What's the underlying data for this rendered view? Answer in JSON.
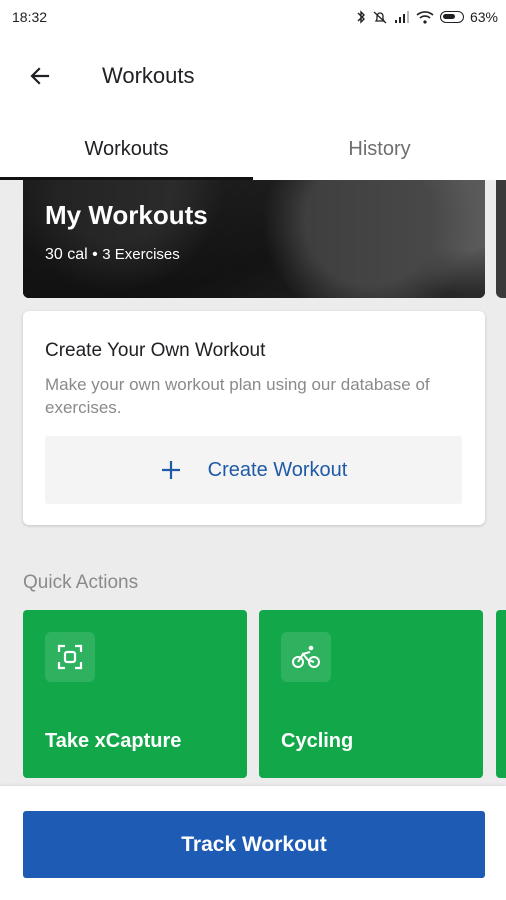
{
  "status_bar": {
    "time": "18:32",
    "battery_percent": "63%",
    "icons": [
      "bluetooth-icon",
      "mute-icon",
      "signal-icon",
      "wifi-icon",
      "battery-icon"
    ]
  },
  "app_bar": {
    "title": "Workouts",
    "back_icon": "arrow-left-icon"
  },
  "tabs": [
    {
      "label": "Workouts",
      "active": true
    },
    {
      "label": "History",
      "active": false
    }
  ],
  "my_workouts_card": {
    "title": "My Workouts",
    "calories": "30 cal",
    "separator": "•",
    "exercises": "3 Exercises"
  },
  "create_card": {
    "heading": "Create Your Own Workout",
    "description": "Make your own workout plan using our database of exercises.",
    "button_label": "Create Workout",
    "button_icon": "plus-icon"
  },
  "quick_actions": {
    "label": "Quick Actions",
    "items": [
      {
        "label": "Take xCapture",
        "icon": "scan-frame-icon"
      },
      {
        "label": "Cycling",
        "icon": "bicycle-icon"
      }
    ]
  },
  "bottom": {
    "track_label": "Track Workout"
  },
  "colors": {
    "accent_blue": "#1e5bb5",
    "link_blue": "#1f5aa6",
    "quick_action_green": "#12a84a",
    "background": "#ececec"
  }
}
